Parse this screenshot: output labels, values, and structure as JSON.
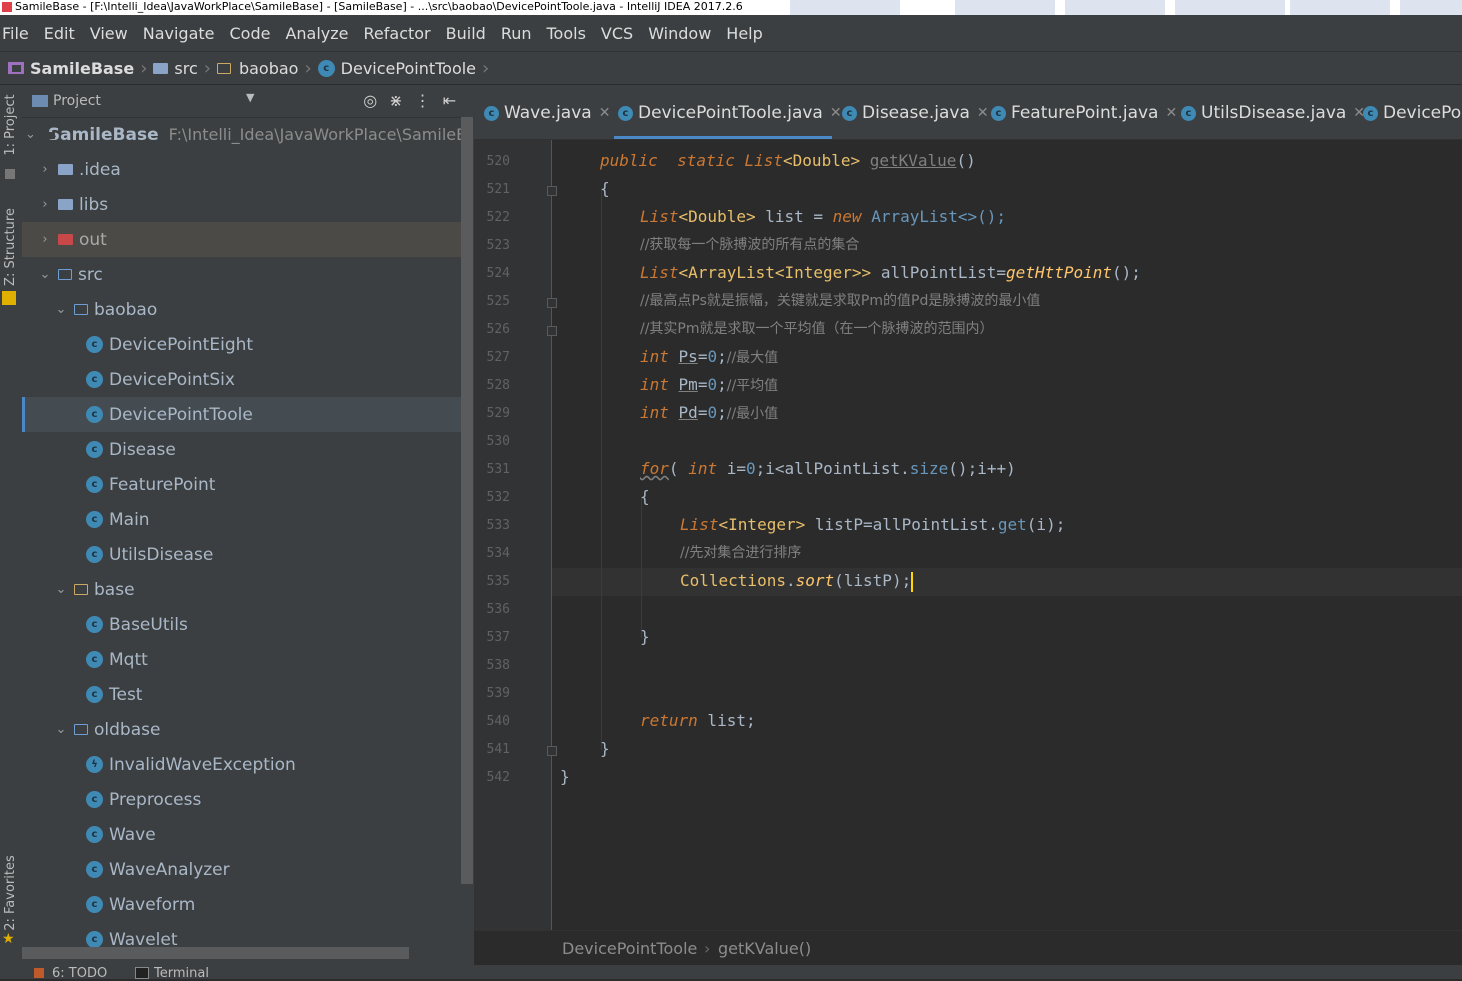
{
  "window": {
    "title": "SamileBase - [F:\\Intelli_Idea\\JavaWorkPlace\\SamileBase] - [SamileBase] - ...\\src\\baobao\\DevicePointToole.java - IntelliJ IDEA 2017.2.6"
  },
  "menu": [
    "File",
    "Edit",
    "View",
    "Navigate",
    "Code",
    "Analyze",
    "Refactor",
    "Build",
    "Run",
    "Tools",
    "VCS",
    "Window",
    "Help"
  ],
  "breadcrumb": {
    "project": "SamileBase",
    "src": "src",
    "package": "baobao",
    "file": "DevicePointToole"
  },
  "side_tabs": {
    "project": "1: Project",
    "structure": "Z: Structure",
    "favorites": "2: Favorites"
  },
  "project_panel": {
    "title": "Project",
    "root_name": "SamileBase",
    "root_path": "F:\\Intelli_Idea\\JavaWorkPlace\\SamileBase",
    "tree": [
      {
        "label": ".idea",
        "kind": "folder"
      },
      {
        "label": "libs",
        "kind": "folder"
      },
      {
        "label": "out",
        "kind": "folder-excluded"
      },
      {
        "label": "src",
        "kind": "source-folder"
      },
      {
        "label": "baobao",
        "kind": "package"
      },
      {
        "label": "DevicePointEight",
        "kind": "class"
      },
      {
        "label": "DevicePointSix",
        "kind": "class"
      },
      {
        "label": "DevicePointToole",
        "kind": "class"
      },
      {
        "label": "Disease",
        "kind": "class"
      },
      {
        "label": "FeaturePoint",
        "kind": "class"
      },
      {
        "label": "Main",
        "kind": "main-class"
      },
      {
        "label": "UtilsDisease",
        "kind": "class"
      },
      {
        "label": "base",
        "kind": "package"
      },
      {
        "label": "BaseUtils",
        "kind": "main-class"
      },
      {
        "label": "Mqtt",
        "kind": "main-class"
      },
      {
        "label": "Test",
        "kind": "main-class"
      },
      {
        "label": "oldbase",
        "kind": "package"
      },
      {
        "label": "InvalidWaveException",
        "kind": "exception"
      },
      {
        "label": "Preprocess",
        "kind": "class"
      },
      {
        "label": "Wave",
        "kind": "class"
      },
      {
        "label": "WaveAnalyzer",
        "kind": "class"
      },
      {
        "label": "Waveform",
        "kind": "class"
      },
      {
        "label": "Wavelet",
        "kind": "class"
      }
    ]
  },
  "editor_tabs": [
    "Wave.java",
    "DevicePointToole.java",
    "Disease.java",
    "FeaturePoint.java",
    "UtilsDisease.java",
    "DevicePoi"
  ],
  "active_tab": "DevicePointToole.java",
  "line_numbers": [
    "520",
    "521",
    "522",
    "523",
    "524",
    "525",
    "526",
    "527",
    "528",
    "529",
    "530",
    "531",
    "532",
    "533",
    "534",
    "535",
    "536",
    "537",
    "538",
    "539",
    "540",
    "541",
    "542"
  ],
  "code": {
    "l520": {
      "public": "public",
      "static": "static",
      "type": "List",
      "generic": "<Double>",
      "method": "getKValue",
      "parens": "()"
    },
    "l521": "{",
    "l522": {
      "type": "List",
      "generic": "<Double>",
      "var": " list = ",
      "new": "new",
      "ctor": " ArrayList<>();"
    },
    "l523": "//获取每一个脉搏波的所有点的集合",
    "l524": {
      "type": "List",
      "generic": "<ArrayList<Integer>>",
      "var": " allPointList=",
      "call": "getHttPoint",
      "end": "();"
    },
    "l525": "//最高点Ps就是振幅，关键就是求取Pm的值Pd是脉搏波的最小值",
    "l526": "//其实Pm就是求取一个平均值（在一个脉搏波的范围内）",
    "l527": {
      "kw": "int",
      "name": "Ps",
      "eq": "=",
      "num": "0",
      "semi": ";",
      "comment": "//最大值"
    },
    "l528": {
      "kw": "int",
      "name": "Pm",
      "eq": "=",
      "num": "0",
      "semi": ";",
      "comment": "//平均值"
    },
    "l529": {
      "kw": "int",
      "name": "Pd",
      "eq": "=",
      "num": "0",
      "semi": ";",
      "comment": "//最小值"
    },
    "l531": {
      "for": "for",
      "open": "(",
      "int": "int",
      "rest1": " i=",
      "num": "0",
      "rest2": ";i<allPointList.",
      "size": "size",
      "rest3": "();i++)"
    },
    "l532": "{",
    "l533": {
      "type": "List",
      "generic": "<Integer>",
      "rest": " listP=allPointList.",
      "get": "get",
      "end": "(i);"
    },
    "l534": "//先对集合进行排序",
    "l535": {
      "cls": "Collections",
      "dot": ".",
      "sort": "sort",
      "end": "(listP);"
    },
    "l537": "}",
    "l540": {
      "return": "return",
      "rest": " list;"
    },
    "l541": "}",
    "l542": "}"
  },
  "editor_breadcrumb": {
    "class": "DevicePointToole",
    "method": "getKValue()"
  },
  "bottom_tools": {
    "todo": "6: TODO",
    "terminal": "Terminal"
  },
  "colors": {
    "accent": "#4a88c7",
    "background": "#2b2b2b",
    "panel": "#3c3f41",
    "keyword": "#cc7832",
    "number": "#6897bb",
    "comment": "#808080"
  }
}
